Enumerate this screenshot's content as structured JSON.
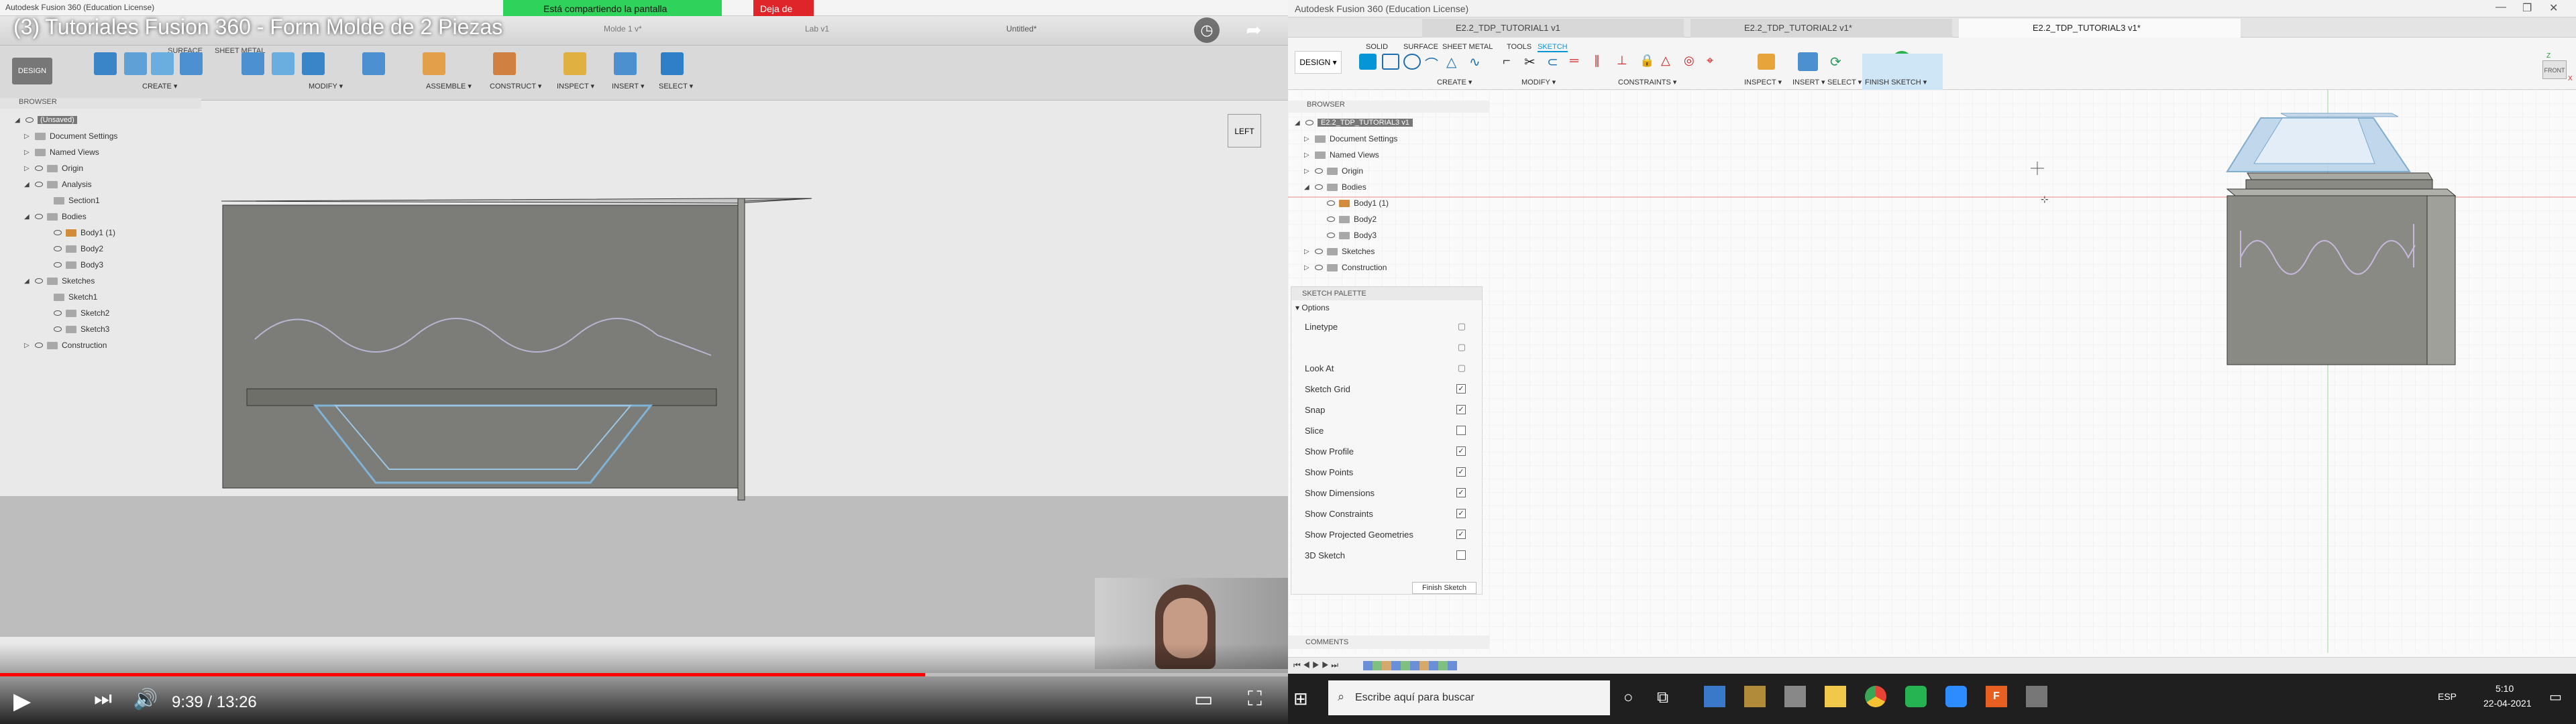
{
  "left": {
    "win_title": "Autodesk Fusion 360 (Education License)",
    "share_text": "Está compartiendo la pantalla",
    "stop_share": "Deja de",
    "video_title": "(3) Tutoriales Fusion 360 - Form Molde de 2 Piezas",
    "toolbar": {
      "design": "DESIGN",
      "create": "CREATE ▾",
      "modify": "MODIFY ▾",
      "assemble": "ASSEMBLE ▾",
      "construct": "CONSTRUCT ▾",
      "inspect": "INSPECT ▾",
      "insert": "INSERT ▾",
      "select": "SELECT ▾",
      "tab_surface": "SURFACE",
      "tab_sheet": "SHEET METAL"
    },
    "doc_tabs": [
      "Molde 1 v*",
      "Lab v1",
      "Untitled*"
    ],
    "browser_title": "BROWSER",
    "tree": [
      "(Unsaved)",
      "Document Settings",
      "Named Views",
      "Origin",
      "Analysis",
      "Section1",
      "Bodies",
      "Body1 (1)",
      "Body2",
      "Body3",
      "Sketches",
      "Sketch1",
      "Sketch2",
      "Sketch3",
      "Construction"
    ],
    "viewcube": "LEFT",
    "time": "9:39 / 13:26"
  },
  "right": {
    "win_title": "Autodesk Fusion 360 (Education License)",
    "tabs": [
      "E2.2_TDP_TUTORIAL1 v1",
      "E2.2_TDP_TUTORIAL2 v1*",
      "E2.2_TDP_TUTORIAL3 v1*"
    ],
    "ribbon_tabs": [
      "SOLID",
      "SURFACE",
      "SHEET METAL",
      "TOOLS",
      "SKETCH"
    ],
    "design": "DESIGN ▾",
    "groups": {
      "create": "CREATE ▾",
      "modify": "MODIFY ▾",
      "constraints": "CONSTRAINTS ▾",
      "inspect": "INSPECT ▾",
      "insert": "INSERT ▾",
      "select": "SELECT ▾",
      "finish": "FINISH SKETCH ▾"
    },
    "browser_title": "BROWSER",
    "tree": [
      "E2.2_TDP_TUTORIAL3 v1",
      "Document Settings",
      "Named Views",
      "Origin",
      "Bodies",
      "Body1 (1)",
      "Body2",
      "Body3",
      "Sketches",
      "Construction"
    ],
    "palette_title": "SKETCH PALETTE",
    "palette_section": "Options",
    "palette_rows": [
      {
        "label": "Linetype",
        "checked": null
      },
      {
        "label": "",
        "checked": null
      },
      {
        "label": "Look At",
        "checked": null
      },
      {
        "label": "Sketch Grid",
        "checked": true
      },
      {
        "label": "Snap",
        "checked": true
      },
      {
        "label": "Slice",
        "checked": false
      },
      {
        "label": "Show Profile",
        "checked": true
      },
      {
        "label": "Show Points",
        "checked": true
      },
      {
        "label": "Show Dimensions",
        "checked": true
      },
      {
        "label": "Show Constraints",
        "checked": true
      },
      {
        "label": "Show Projected Geometries",
        "checked": true
      },
      {
        "label": "3D Sketch",
        "checked": false
      }
    ],
    "finish_btn": "Finish Sketch",
    "comments": "COMMENTS",
    "viewcube": "FRONT",
    "axis_z": "Z",
    "axis_x": "X"
  },
  "taskbar": {
    "search_placeholder": "Escribe aquí para buscar",
    "lang": "ESP",
    "time": "5:10",
    "date": "22-04-2021"
  },
  "colors": {
    "accent": "#0696d7",
    "progress": "#ff0000",
    "share_green": "#2fd25a",
    "stop_red": "#e0252a",
    "body_grey": "#8a8a84"
  }
}
